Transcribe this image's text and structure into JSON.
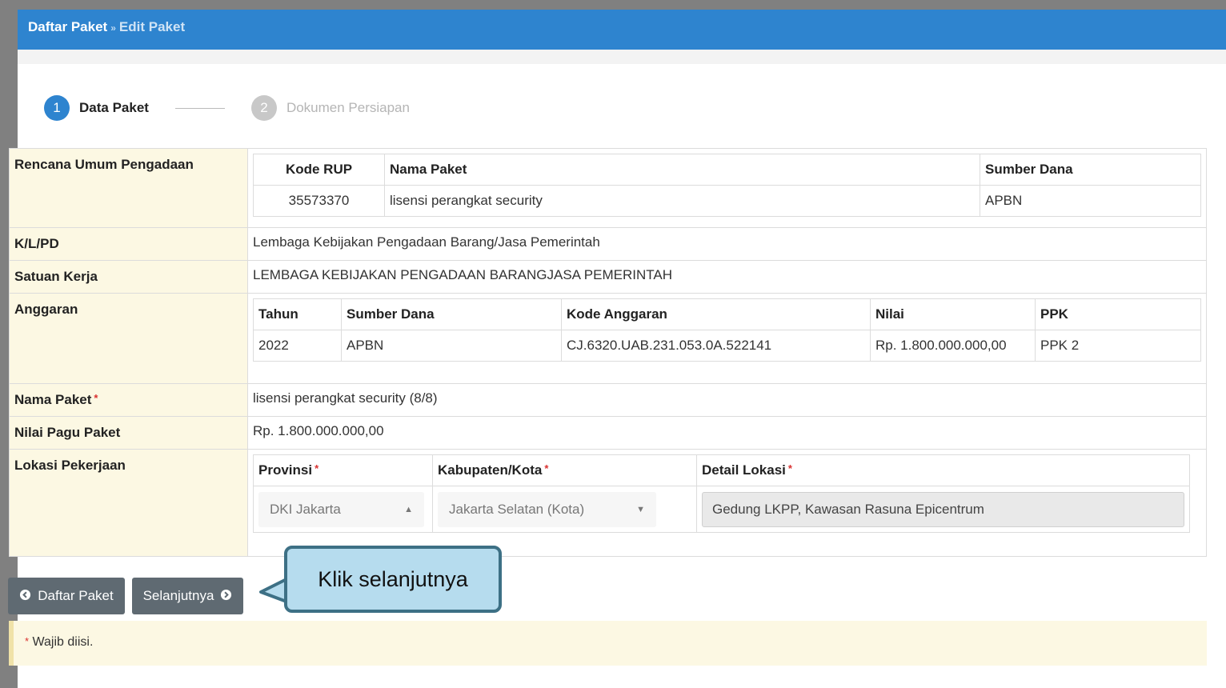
{
  "breadcrumb": {
    "parent": "Daftar Paket",
    "separator": "»",
    "current": "Edit Paket"
  },
  "steps": [
    {
      "number": "1",
      "label": "Data Paket"
    },
    {
      "number": "2",
      "label": "Dokumen Persiapan"
    }
  ],
  "form": {
    "rup": {
      "label": "Rencana Umum Pengadaan",
      "headers": [
        "Kode RUP",
        "Nama Paket",
        "Sumber Dana"
      ],
      "row": [
        "35573370",
        "lisensi perangkat security",
        "APBN"
      ]
    },
    "klpd": {
      "label": "K/L/PD",
      "value": "Lembaga Kebijakan Pengadaan Barang/Jasa Pemerintah"
    },
    "satuan_kerja": {
      "label": "Satuan Kerja",
      "value": "LEMBAGA KEBIJAKAN PENGADAAN BARANGJASA PEMERINTAH"
    },
    "anggaran": {
      "label": "Anggaran",
      "headers": [
        "Tahun",
        "Sumber Dana",
        "Kode Anggaran",
        "Nilai",
        "PPK"
      ],
      "row": [
        "2022",
        "APBN",
        "CJ.6320.UAB.231.053.0A.522141",
        "Rp. 1.800.000.000,00",
        "PPK 2"
      ]
    },
    "nama_paket": {
      "label": "Nama Paket",
      "required_mark": "*",
      "value": "lisensi perangkat security (8/8)"
    },
    "nilai_pagu": {
      "label": "Nilai Pagu Paket",
      "value": "Rp. 1.800.000.000,00"
    },
    "lokasi": {
      "label": "Lokasi Pekerjaan",
      "headers": [
        "Provinsi",
        "Kabupaten/Kota",
        "Detail Lokasi"
      ],
      "provinsi": "DKI Jakarta",
      "kabupaten": "Jakarta Selatan (Kota)",
      "detail": "Gedung LKPP, Kawasan Rasuna Epicentrum"
    }
  },
  "buttons": {
    "back": "Daftar Paket",
    "next": "Selanjutnya"
  },
  "callout": "Klik selanjutnya",
  "note": {
    "mark": "*",
    "text": "Wajib diisi."
  },
  "colors": {
    "header": "#2e84cf",
    "label_bg": "#fcf8e3",
    "button": "#5f6a72",
    "callout_bg": "#b6dcee",
    "required": "#d9302f"
  },
  "icons": [
    "arrow-left-circle-icon",
    "arrow-right-circle-icon",
    "caret-up-icon",
    "caret-down-icon"
  ]
}
